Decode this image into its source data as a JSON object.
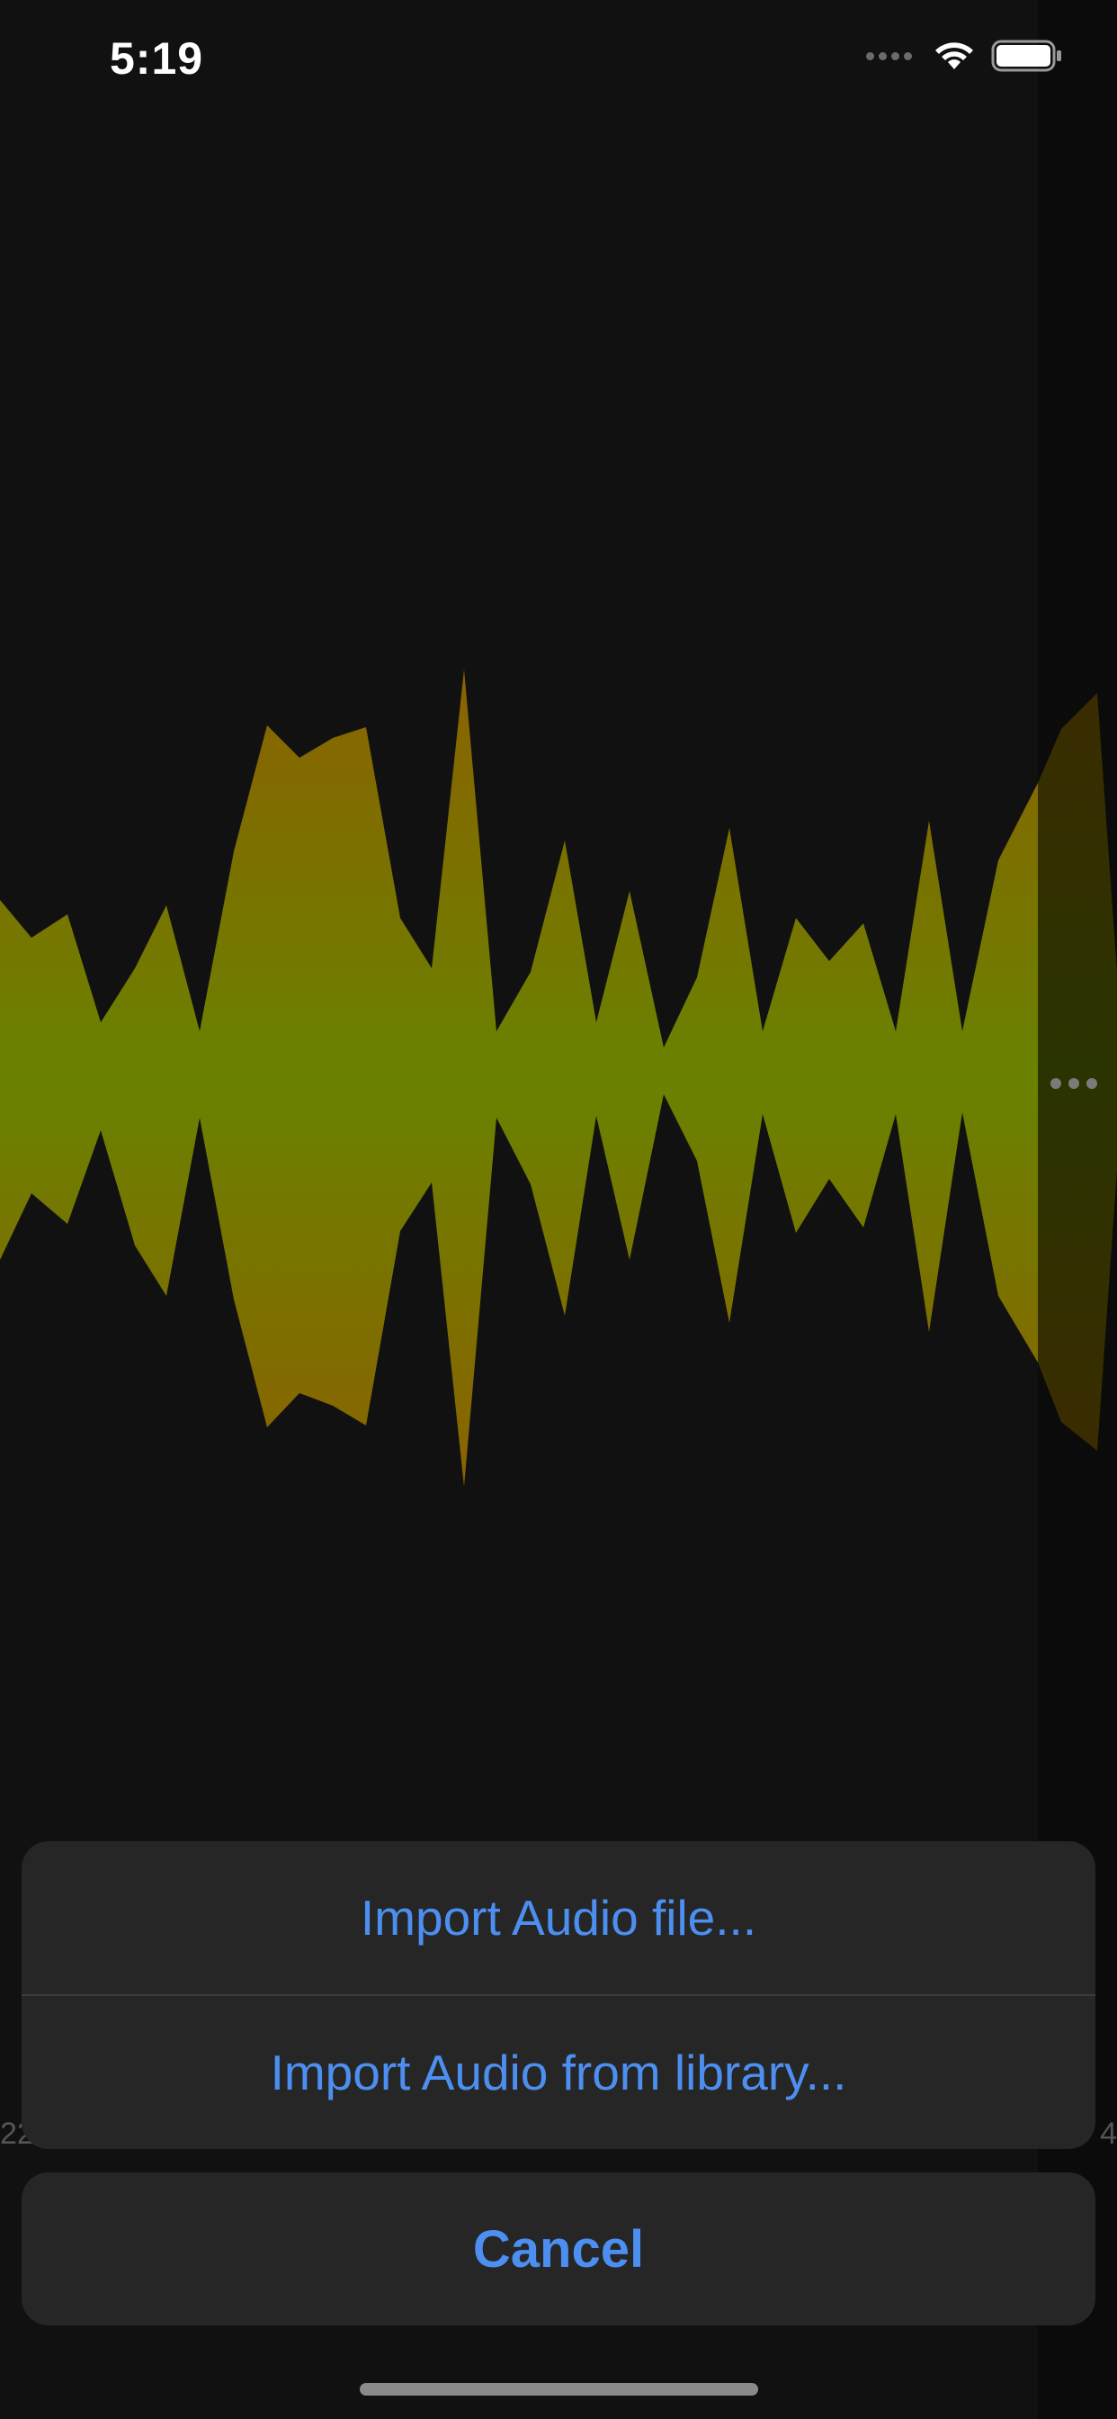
{
  "status_bar": {
    "time": "5:19",
    "icons": [
      "signal-icon",
      "wifi-icon",
      "battery-icon"
    ]
  },
  "track": {
    "time_start": "22",
    "time_end": "4",
    "more_icon": "more-horizontal-icon"
  },
  "action_sheet": {
    "items": [
      {
        "label": "Import Audio file..."
      },
      {
        "label": "Import Audio from library..."
      }
    ],
    "cancel_label": "Cancel"
  },
  "colors": {
    "accent": "#4c8ff0",
    "wave_center": "#6a8200",
    "wave_edge": "#8a6400"
  }
}
